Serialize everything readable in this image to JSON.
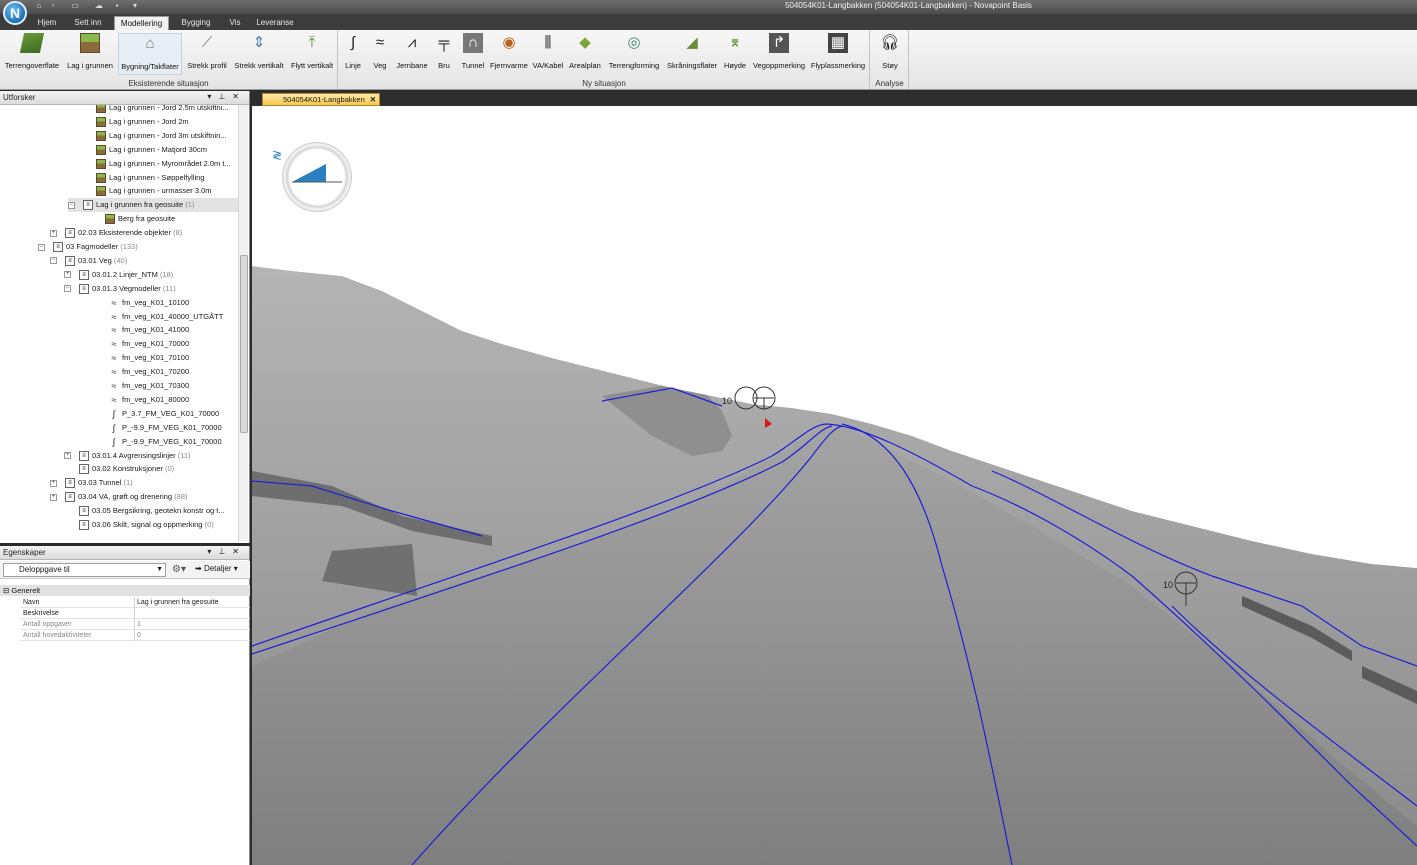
{
  "window": {
    "title": "504054K01-Langbakken (504054K01-Langbakken) - Novapoint Basis"
  },
  "app_button": {
    "letter": "N"
  },
  "ribbon_tabs": [
    {
      "label": "Hjem"
    },
    {
      "label": "Sett inn"
    },
    {
      "label": "Modellering"
    },
    {
      "label": "Bygging"
    },
    {
      "label": "Vis"
    },
    {
      "label": "Leveranse"
    }
  ],
  "ribbon": {
    "existing_group": "Eksisterende situasjon",
    "new_group": "Ny situasjon",
    "analysis_group": "Analyse",
    "existing_buttons": [
      {
        "label": "Terrengoverflate",
        "icon": "terrain-surface-icon"
      },
      {
        "label": "Lag i grunnen",
        "icon": "ground-layer-icon"
      },
      {
        "label": "Bygning/Takflater",
        "icon": "building-icon"
      },
      {
        "label": "Strekk profil",
        "icon": "stretch-profile-icon"
      },
      {
        "label": "Strekk vertikalt",
        "icon": "stretch-vertical-icon"
      },
      {
        "label": "Flytt vertikalt",
        "icon": "move-vertical-icon"
      }
    ],
    "new_buttons": [
      {
        "label": "Linje",
        "icon": "line-icon"
      },
      {
        "label": "Veg",
        "icon": "road-icon"
      },
      {
        "label": "Jernbane",
        "icon": "railway-icon"
      },
      {
        "label": "Bru",
        "icon": "bridge-icon"
      },
      {
        "label": "Tunnel",
        "icon": "tunnel-icon"
      },
      {
        "label": "Fjernvarme",
        "icon": "district-heating-icon"
      },
      {
        "label": "VA/Kabel",
        "icon": "water-cable-icon"
      },
      {
        "label": "Arealplan",
        "icon": "area-plan-icon"
      },
      {
        "label": "Terrengforming",
        "icon": "terrain-forming-icon"
      },
      {
        "label": "Skråningsflater",
        "icon": "slope-surfaces-icon"
      },
      {
        "label": "Høyde",
        "icon": "height-icon"
      },
      {
        "label": "Vegoppmerking",
        "icon": "road-marking-icon"
      },
      {
        "label": "Flyplassmerking",
        "icon": "airport-marking-icon"
      }
    ],
    "analysis_buttons": [
      {
        "label": "Støy",
        "icon": "noise-icon"
      }
    ]
  },
  "explorer": {
    "title": "Utforsker",
    "tree": [
      {
        "label": "Lag i grunnen - Jord 2.5m utskiftni...",
        "count": "",
        "icon": "layer",
        "expander": ""
      },
      {
        "label": "Lag i grunnen - Jord 2m",
        "count": "",
        "icon": "layer",
        "expander": ""
      },
      {
        "label": "Lag i grunnen - Jord 3m utskiftnin...",
        "count": "",
        "icon": "layer",
        "expander": ""
      },
      {
        "label": "Lag i grunnen - Matjord 30cm",
        "count": "",
        "icon": "layer",
        "expander": ""
      },
      {
        "label": "Lag i grunnen - Myrområdet 2.0m t...",
        "count": "",
        "icon": "layer",
        "expander": ""
      },
      {
        "label": "Lag i grunnen - Søppelfylling",
        "count": "",
        "icon": "layer",
        "expander": ""
      },
      {
        "label": "Lag i grunnen - urmasser 3.0m",
        "count": "",
        "icon": "layer",
        "expander": ""
      },
      {
        "label": "Lag i grunnen fra geosuite",
        "count": "(1)",
        "icon": "folder",
        "expander": "−"
      },
      {
        "label": "Berg fra geosuite",
        "count": "",
        "icon": "layer",
        "expander": ""
      },
      {
        "label": "02.03 Eksisterende objekter",
        "count": "(8)",
        "icon": "folder",
        "expander": "+"
      },
      {
        "label": "03 Fagmodeller",
        "count": "(133)",
        "icon": "folder",
        "expander": "−"
      },
      {
        "label": "03.01 Veg",
        "count": "(40)",
        "icon": "folder",
        "expander": "−"
      },
      {
        "label": "03.01.2 Linjer_NTM",
        "count": "(18)",
        "icon": "folder",
        "expander": "+"
      },
      {
        "label": "03.01.3 Vegmodeller",
        "count": "(11)",
        "icon": "folder",
        "expander": "−"
      },
      {
        "label": "fm_veg_K01_10100",
        "count": "",
        "icon": "road",
        "expander": ""
      },
      {
        "label": "fm_veg_K01_40000_UTGÅTT",
        "count": "",
        "icon": "road",
        "expander": ""
      },
      {
        "label": "fm_veg_K01_41000",
        "count": "",
        "icon": "road",
        "expander": ""
      },
      {
        "label": "fm_veg_K01_70000",
        "count": "",
        "icon": "road",
        "expander": ""
      },
      {
        "label": "fm_veg_K01_70100",
        "count": "",
        "icon": "road",
        "expander": ""
      },
      {
        "label": "fm_veg_K01_70200",
        "count": "",
        "icon": "road",
        "expander": ""
      },
      {
        "label": "fm_veg_K01_70300",
        "count": "",
        "icon": "road",
        "expander": ""
      },
      {
        "label": "fm_veg_K01_80000",
        "count": "",
        "icon": "road",
        "expander": ""
      },
      {
        "label": "P_3.7_FM_VEG_K01_70000",
        "count": "",
        "icon": "line",
        "expander": ""
      },
      {
        "label": "P_-9.9_FM_VEG_K01_70000",
        "count": "",
        "icon": "line",
        "expander": ""
      },
      {
        "label": "P_-9.9_FM_VEG_K01_70000",
        "count": "",
        "icon": "line",
        "expander": ""
      },
      {
        "label": "03.01.4 Avgrensingslinjer",
        "count": "(11)",
        "icon": "folder",
        "expander": "+"
      },
      {
        "label": "03.02 Konstruksjoner",
        "count": "(0)",
        "icon": "folder",
        "expander": ""
      },
      {
        "label": "03.03 Tunnel",
        "count": "(1)",
        "icon": "folder",
        "expander": "+"
      },
      {
        "label": "03.04 VA, grøft og drenering",
        "count": "(88)",
        "icon": "folder",
        "expander": "+"
      },
      {
        "label": "03.05 Bergsikring, geotekn konstr og t...",
        "count": "",
        "icon": "folder",
        "expander": ""
      },
      {
        "label": "03.06 Skilt, signal og oppmerking",
        "count": "(0)",
        "icon": "folder",
        "expander": ""
      }
    ]
  },
  "properties": {
    "title": "Egenskaper",
    "selector": "Deloppgave til",
    "details_label": "Detaljer",
    "group": "Generelt",
    "rows": [
      {
        "key": "Navn",
        "value": "Lag i grunnen fra geosuite"
      },
      {
        "key": "Beskrivelse",
        "value": ""
      },
      {
        "key": "Antall oppgaver",
        "value": "1"
      },
      {
        "key": "Antall hovedaktiviteter",
        "value": "0"
      }
    ]
  },
  "document_tab": {
    "label": "504054K01-Langbakken"
  },
  "viewport": {
    "marker_labels": [
      "10",
      "10"
    ],
    "colors": {
      "terrain": "#9c9c9c",
      "road": "#8e8e8e",
      "alignment": "#1f1fd6",
      "marker": "#d41a1a"
    }
  }
}
